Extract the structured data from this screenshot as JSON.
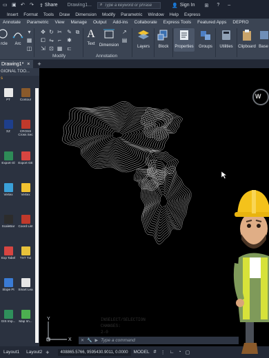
{
  "titlebar": {
    "share_label": "Share",
    "doc_title": "Drawing1...",
    "search_placeholder": "Type a keyword or phrase",
    "signin_label": "Sign In"
  },
  "menu": [
    "Insert",
    "Format",
    "Tools",
    "Draw",
    "Dimension",
    "Modify",
    "Parametric",
    "Window",
    "Help",
    "Express"
  ],
  "ribbon_tabs": [
    "Annotate",
    "Parametric",
    "View",
    "Manage",
    "Output",
    "Add-ins",
    "Collaborate",
    "Express Tools",
    "Featured Apps",
    "DEPRO"
  ],
  "ribbon": {
    "draw_partial_a": "rcle",
    "draw_partial_b": "Arc",
    "modify_label": "Modify",
    "text_label": "Text",
    "dimension_label": "Dimension",
    "annotation_label": "Annotation",
    "layers_label": "Layers",
    "block_label": "Block",
    "properties_label": "Properties",
    "groups_label": "Groups",
    "utilities_label": "Utilities",
    "clipboard_label": "Clipboard",
    "base_label": "Base"
  },
  "filetab": {
    "label": "Drawing1*"
  },
  "palette": {
    "header": "GIONAL TOO...",
    "subheader": "s",
    "items": [
      {
        "label": "PT",
        "color": "#e8e8e8"
      },
      {
        "label": "Contour",
        "color": "#8a5a2b"
      },
      {
        "label": "ΣΖ",
        "color": "#1e3f8c"
      },
      {
        "label": "CROSS Cross Sec",
        "color": "#c0392b"
      },
      {
        "label": "Export Gl",
        "color": "#2e8b57"
      },
      {
        "label": "Export GE",
        "color": "#d64541"
      },
      {
        "label": "Vertex",
        "color": "#3aa0d8"
      },
      {
        "label": "Vertex",
        "color": "#f2c230"
      },
      {
        "label": "ScaleBar",
        "color": "#2c2c2c"
      },
      {
        "label": "Coord List",
        "color": "#c0392b"
      },
      {
        "label": "Exp Tabel",
        "color": "#d64541"
      },
      {
        "label": "TXT Txt",
        "color": "#e8c23a"
      },
      {
        "label": "Slope Pt",
        "color": "#3a7bd5"
      },
      {
        "label": "Smart Lea",
        "color": "#e6e6e6"
      },
      {
        "label": "GIS Imp...",
        "color": "#2f8f5b"
      },
      {
        "label": "Map Im...",
        "color": "#4caf50"
      }
    ]
  },
  "canvas": {
    "viewcube_label": "W",
    "ucs_y": "Y",
    "ucs_x": "X"
  },
  "command": {
    "history": [
      "INSELECT/SELECTION",
      "CHANGES:",
      "2-0"
    ],
    "placeholder": "Type a command"
  },
  "status": {
    "layout1": "Layout1",
    "layout2": "Layout2",
    "coords": "408865.5766, 9595430.9011, 0.0000",
    "model": "MODEL"
  },
  "colors": {
    "chrome_dark": "#1d2330",
    "ribbon": "#3b4453",
    "palette": "#2b3240",
    "canvas": "#000000",
    "accent": "#ffb43c"
  }
}
